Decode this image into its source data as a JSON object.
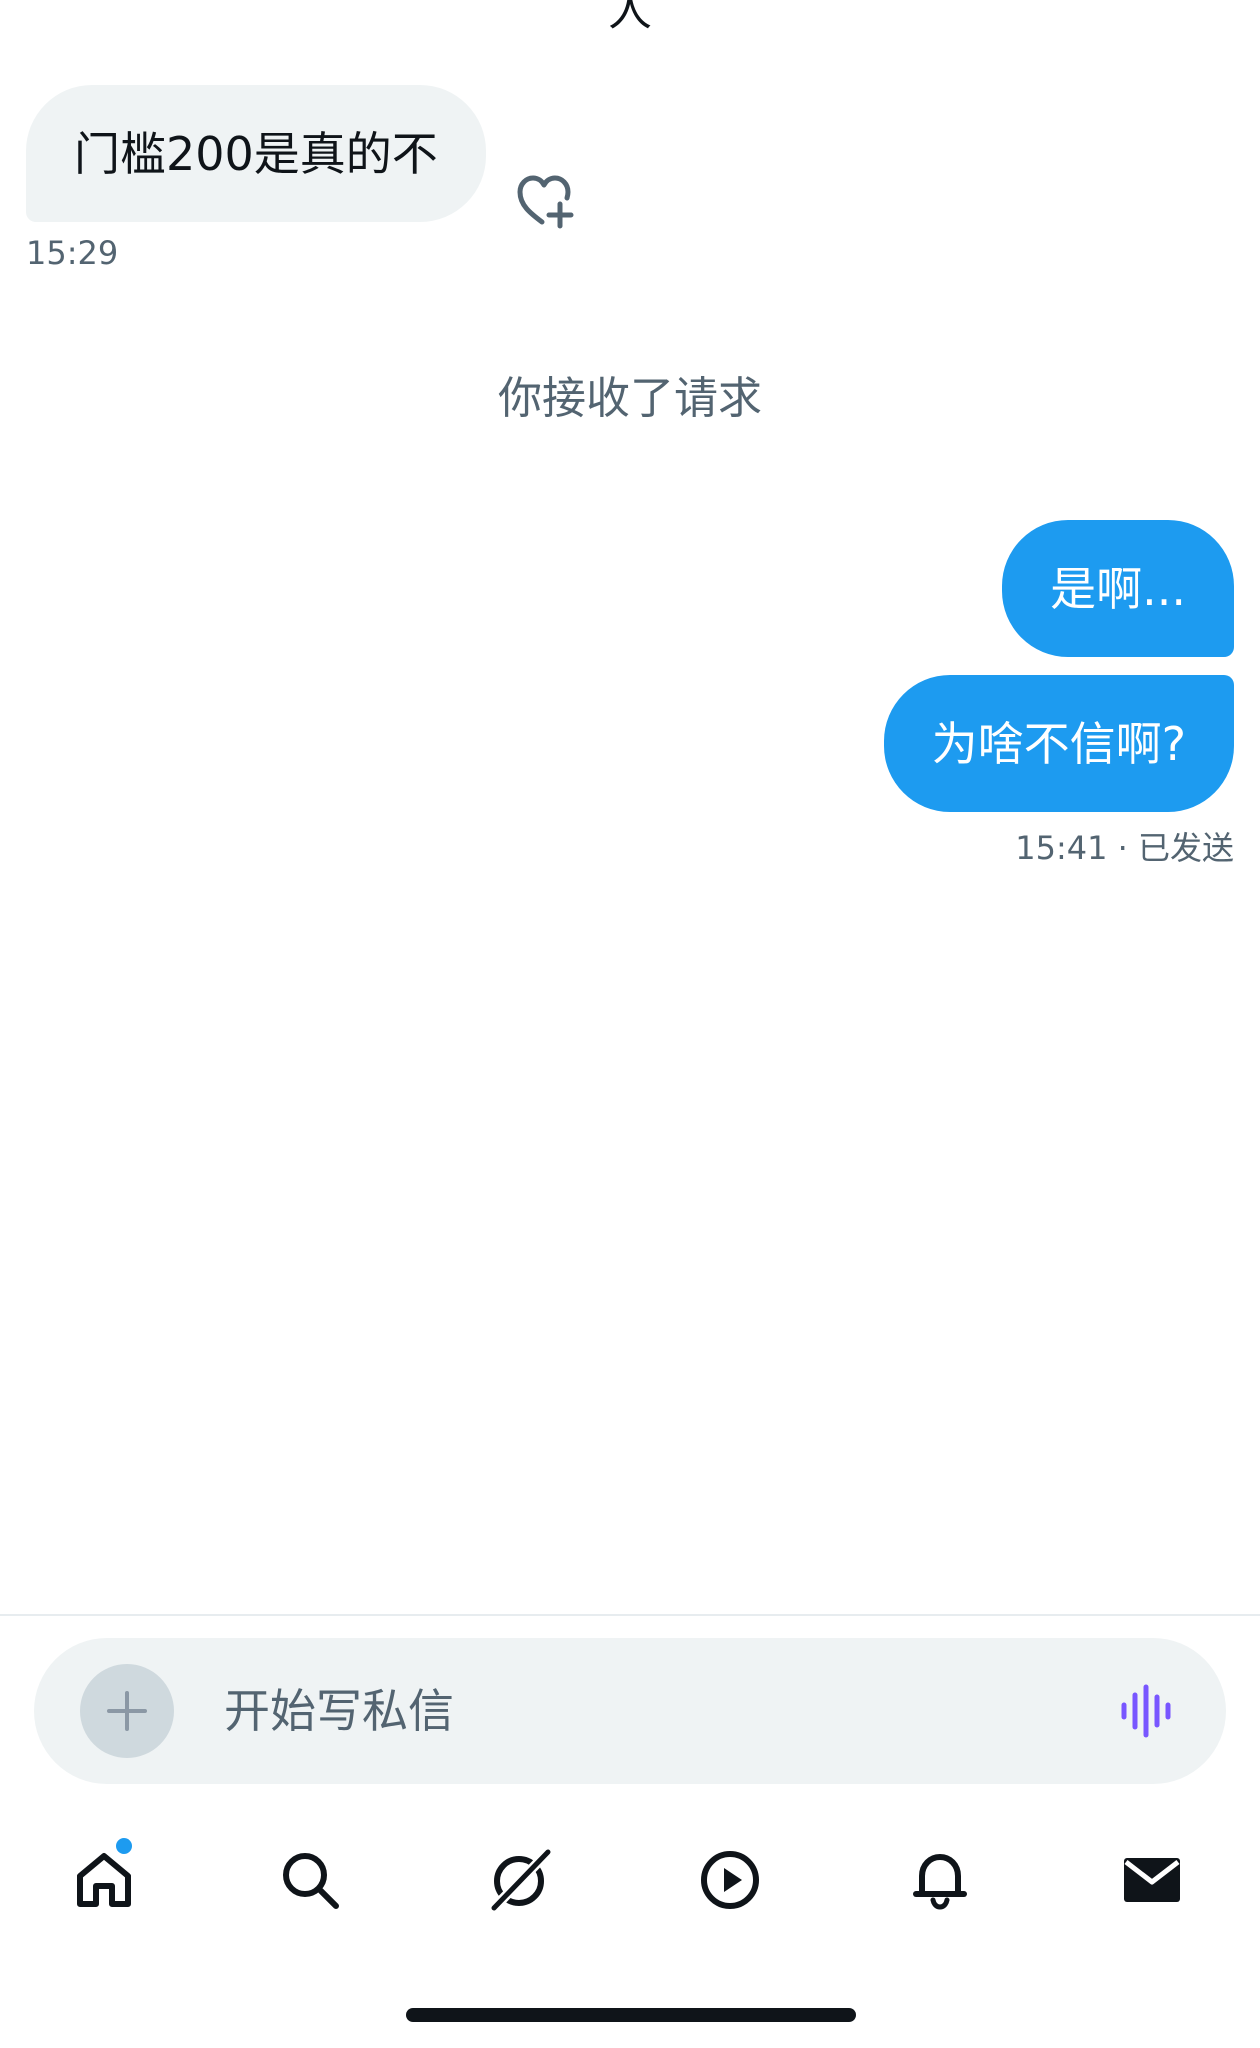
{
  "header": {
    "cut_title": "人"
  },
  "conversation": {
    "incoming": {
      "text": "门槛200是真的不",
      "time": "15:29"
    },
    "system_note": "你接收了请求",
    "outgoing": [
      {
        "text": "是啊..."
      },
      {
        "text": "为啥不信啊?"
      }
    ],
    "outgoing_status": "15:41 · 已发送"
  },
  "composer": {
    "placeholder": "开始写私信"
  },
  "nav": {
    "items": [
      "home",
      "search",
      "grok",
      "video",
      "notifications",
      "messages"
    ],
    "home_badge": true
  },
  "colors": {
    "accent": "#1d9bf0",
    "voice": "#7856ff",
    "bubble_in": "#eff3f4",
    "meta_text": "#536471"
  }
}
